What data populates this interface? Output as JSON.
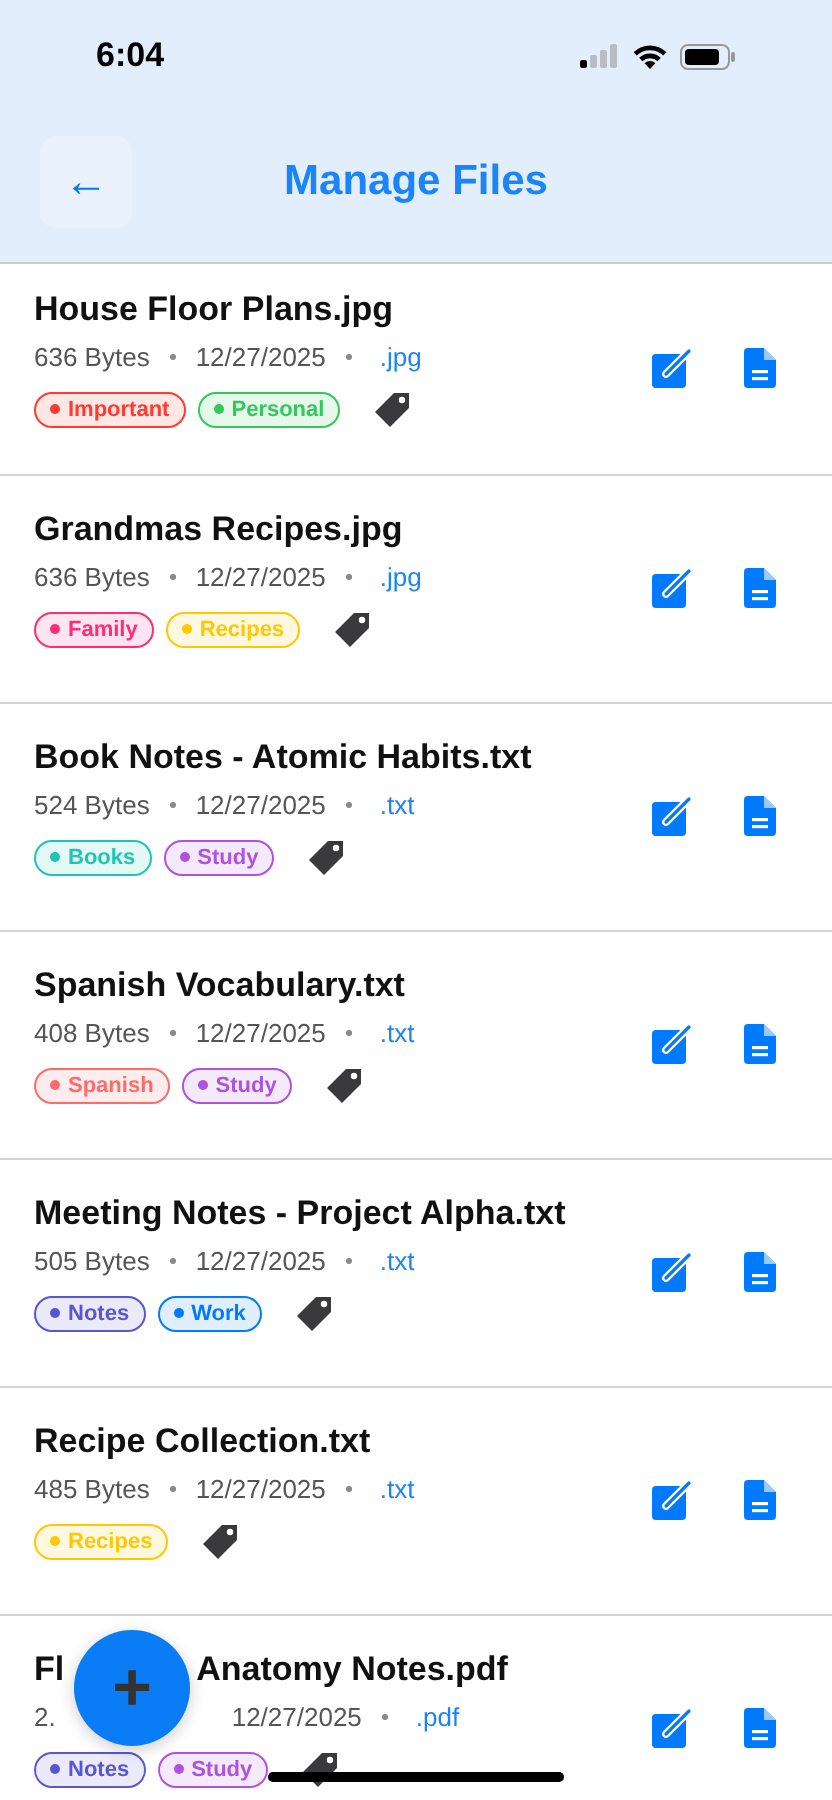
{
  "status_bar": {
    "time": "6:04"
  },
  "header": {
    "back_icon": "←",
    "title": "Manage Files"
  },
  "files": [
    {
      "kind": "full",
      "title": "House Floor Plans.jpg",
      "size": "636 Bytes",
      "date": "12/27/2025",
      "ext": ".jpg",
      "tags": [
        {
          "label": "Important",
          "color": "#ff3b30"
        },
        {
          "label": "Personal",
          "color": "#34c759"
        }
      ]
    },
    {
      "kind": "full",
      "title": "Grandmas Recipes.jpg",
      "size": "636 Bytes",
      "date": "12/27/2025",
      "ext": ".jpg",
      "tags": [
        {
          "label": "Family",
          "color": "#ff2d78"
        },
        {
          "label": "Recipes",
          "color": "#ffc800"
        }
      ]
    },
    {
      "kind": "full",
      "title": "Book Notes - Atomic Habits.txt",
      "size": "524 Bytes",
      "date": "12/27/2025",
      "ext": ".txt",
      "tags": [
        {
          "label": "Books",
          "color": "#20c4b4"
        },
        {
          "label": "Study",
          "color": "#af52de"
        }
      ]
    },
    {
      "kind": "full",
      "title": "Spanish Vocabulary.txt",
      "size": "408 Bytes",
      "date": "12/27/2025",
      "ext": ".txt",
      "tags": [
        {
          "label": "Spanish",
          "color": "#ff6b6b"
        },
        {
          "label": "Study",
          "color": "#af52de"
        }
      ]
    },
    {
      "kind": "full",
      "title": "Meeting Notes - Project Alpha.txt",
      "size": "505 Bytes",
      "date": "12/27/2025",
      "ext": ".txt",
      "tags": [
        {
          "label": "Notes",
          "color": "#5856d6"
        },
        {
          "label": "Work",
          "color": "#007aff"
        }
      ]
    },
    {
      "kind": "full",
      "title": "Recipe Collection.txt",
      "size": "485 Bytes",
      "date": "12/27/2025",
      "ext": ".txt",
      "tags": [
        {
          "label": "Recipes",
          "color": "#ffc800"
        }
      ]
    },
    {
      "kind": "covered",
      "title": "Fl",
      "title_after": "Anatomy Notes.pdf",
      "size": "2.",
      "date": "12/27/2025",
      "ext": ".pdf",
      "tags": [
        {
          "label": "Notes",
          "color": "#5856d6"
        },
        {
          "label": "Study",
          "color": "#af52de"
        }
      ]
    }
  ],
  "fab": {
    "label": "+"
  }
}
